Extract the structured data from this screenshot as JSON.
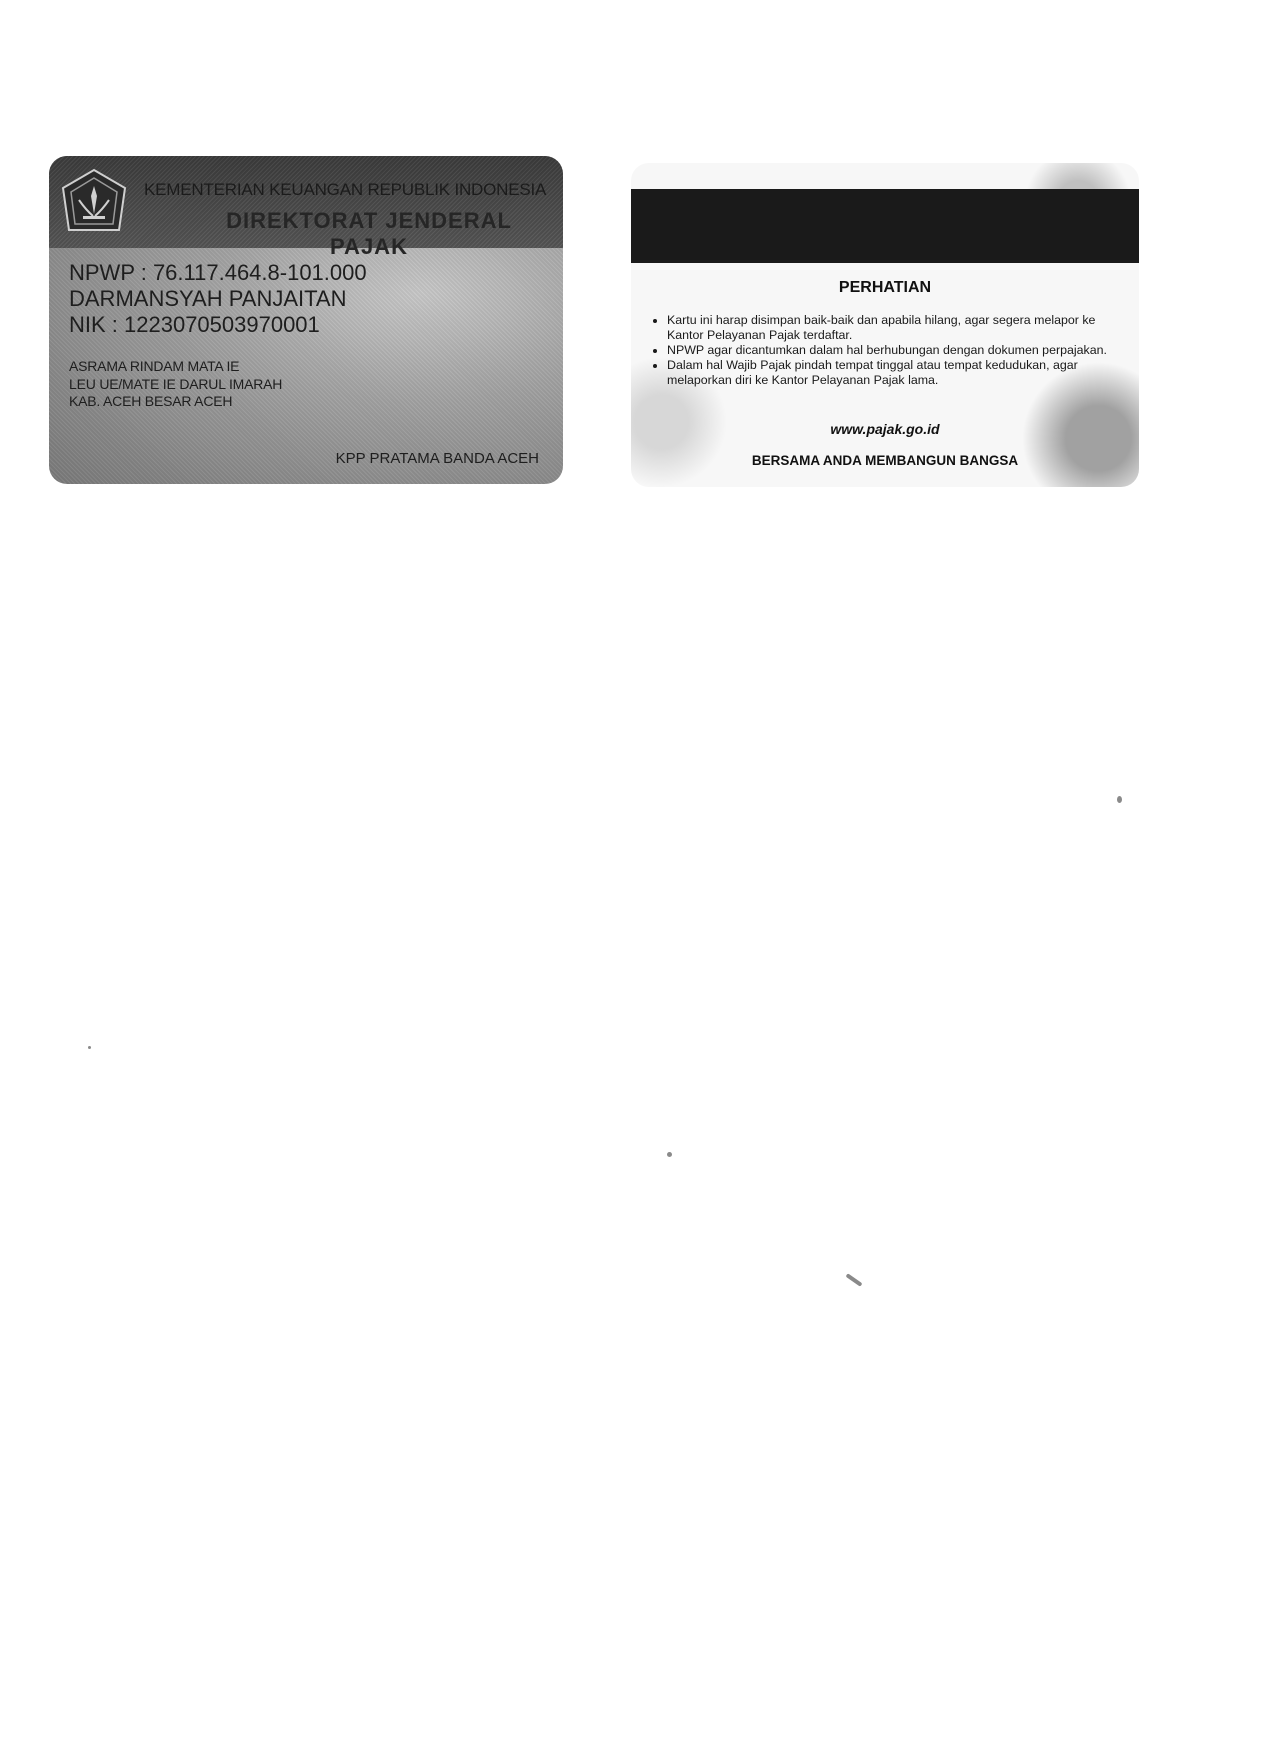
{
  "front": {
    "ministry": "KEMENTERIAN KEUANGAN REPUBLIK INDONESIA",
    "directorate": "DIREKTORAT JENDERAL PAJAK",
    "npwp": "NPWP : 76.117.464.8-101.000",
    "name": "DARMANSYAH PANJAITAN",
    "nik": "NIK : 1223070503970001",
    "address": [
      "ASRAMA RINDAM MATA IE",
      "LEU UE/MATE IE DARUL IMARAH",
      "KAB. ACEH BESAR ACEH"
    ],
    "office": "KPP PRATAMA BANDA ACEH"
  },
  "back": {
    "title": "PERHATIAN",
    "notices": [
      "Kartu ini harap disimpan baik-baik dan apabila hilang, agar segera melapor ke Kantor Pelayanan Pajak terdaftar.",
      "NPWP agar dicantumkan dalam hal berhubungan dengan dokumen perpajakan.",
      "Dalam hal Wajib Pajak pindah tempat tinggal atau tempat kedudukan, agar melaporkan diri ke Kantor Pelayanan Pajak lama."
    ],
    "website": "www.pajak.go.id",
    "slogan": "BERSAMA ANDA MEMBANGUN BANGSA"
  }
}
